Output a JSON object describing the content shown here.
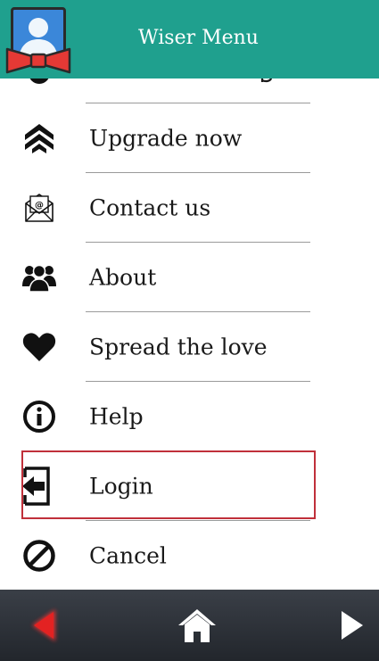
{
  "header": {
    "title": "Wiser Menu",
    "avatar_icon": "profile-bowtie-icon",
    "color": "#1fa08e"
  },
  "menu": {
    "items": [
      {
        "label": "Upgrade now",
        "icon": "chevron-up-double-icon"
      },
      {
        "label": "Contact us",
        "icon": "envelope-at-icon"
      },
      {
        "label": "About",
        "icon": "group-people-icon"
      },
      {
        "label": "Spread the love",
        "icon": "heart-icon"
      },
      {
        "label": "Help",
        "icon": "info-circle-icon"
      },
      {
        "label": "Login",
        "icon": "login-door-icon",
        "highlighted": true
      },
      {
        "label": "Cancel",
        "icon": "cancel-circle-icon"
      }
    ],
    "highlight_color": "#c0303a"
  },
  "bottombar": {
    "back_icon": "triangle-left-icon",
    "home_icon": "home-icon",
    "forward_icon": "triangle-right-icon",
    "back_color": "#e32222"
  }
}
